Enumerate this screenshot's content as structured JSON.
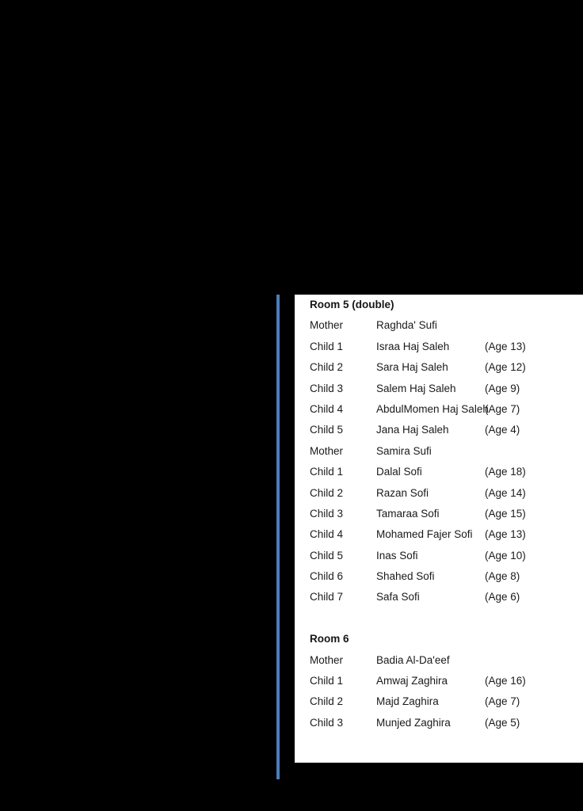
{
  "slide": {
    "background_color": "#000000",
    "panel_color": "#ffffff",
    "accent_color": "#4a7ebb",
    "text_color": "#1a1a1a"
  },
  "sections": [
    {
      "heading": "Room 5 (double)",
      "rows": [
        {
          "role": "Mother",
          "name": "Raghda' Sufi",
          "age": ""
        },
        {
          "role": "Child 1",
          "name": "Israa Haj Saleh",
          "age": "(Age 13)"
        },
        {
          "role": "Child 2",
          "name": "Sara Haj Saleh",
          "age": "(Age 12)"
        },
        {
          "role": "Child 3",
          "name": "Salem Haj Saleh",
          "age": "(Age 9)"
        },
        {
          "role": "Child 4",
          "name": "AbdulMomen Haj Saleh",
          "age": "(Age 7)"
        },
        {
          "role": "Child 5",
          "name": "Jana Haj Saleh",
          "age": "(Age 4)"
        },
        {
          "role": "Mother",
          "name": "Samira Sufi",
          "age": ""
        },
        {
          "role": "Child 1",
          "name": "Dalal Sofi",
          "age": "(Age 18)"
        },
        {
          "role": "Child 2",
          "name": "Razan Sofi",
          "age": "(Age 14)"
        },
        {
          "role": "Child 3",
          "name": "Tamaraa Sofi",
          "age": "(Age 15)"
        },
        {
          "role": "Child 4",
          "name": "Mohamed Fajer Sofi",
          "age": "(Age 13)"
        },
        {
          "role": "Child 5",
          "name": "Inas Sofi",
          "age": "(Age 10)"
        },
        {
          "role": "Child 6",
          "name": "Shahed Sofi",
          "age": "(Age 8)"
        },
        {
          "role": "Child 7",
          "name": "Safa Sofi",
          "age": "(Age 6)"
        }
      ]
    },
    {
      "heading": "Room 6",
      "rows": [
        {
          "role": "Mother",
          "name": "Badia Al-Da'eef",
          "age": ""
        },
        {
          "role": "Child 1",
          "name": "Amwaj Zaghira",
          "age": "(Age 16)"
        },
        {
          "role": "Child 2",
          "name": "Majd Zaghira",
          "age": "(Age 7)"
        },
        {
          "role": "Child 3",
          "name": "Munjed Zaghira",
          "age": "(Age 5)"
        }
      ]
    }
  ]
}
